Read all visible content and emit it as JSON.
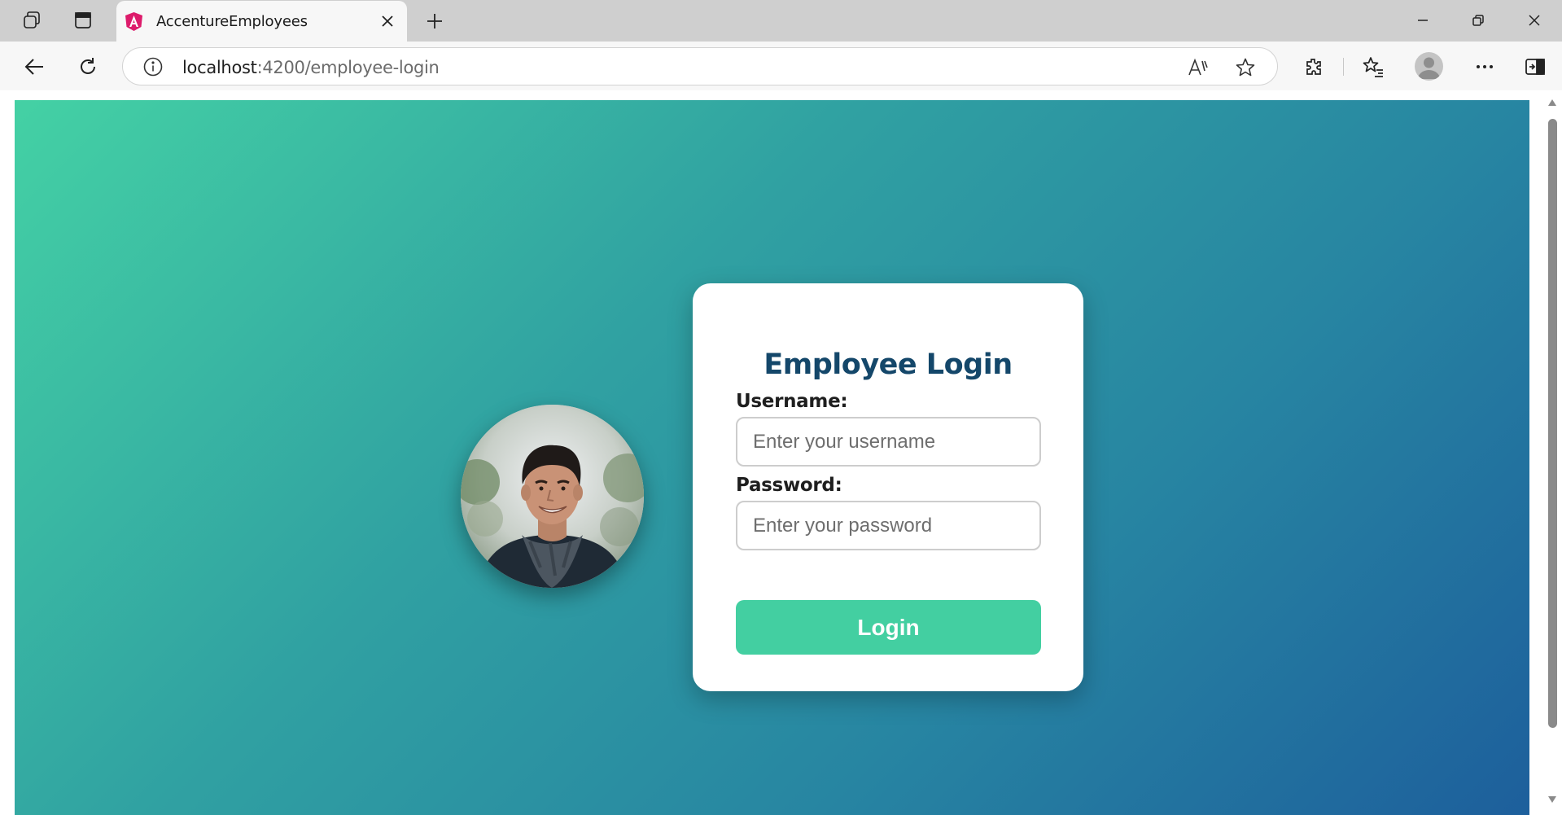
{
  "browser": {
    "tab": {
      "title": "AccentureEmployees",
      "favicon": "angular-logo-icon"
    },
    "url_host": "localhost",
    "url_rest": ":4200/employee-login",
    "icons": [
      "workspaces-icon",
      "tab-actions-icon",
      "close-icon",
      "plus-icon",
      "minimize-icon",
      "restore-icon",
      "window-close-icon",
      "back-arrow-icon",
      "refresh-icon",
      "info-icon",
      "read-aloud-icon",
      "star-icon",
      "extensions-icon",
      "favorites-icon",
      "profile-icon",
      "more-icon",
      "sidebar-icon"
    ]
  },
  "login": {
    "title": "Employee Login",
    "username_label": "Username:",
    "username_placeholder": "Enter your username",
    "password_label": "Password:",
    "password_placeholder": "Enter your password",
    "button_label": "Login"
  },
  "colors": {
    "gradient_start": "#44d1a4",
    "gradient_end": "#1d5f9c",
    "title": "#14476a",
    "button": "#43cfa1"
  }
}
